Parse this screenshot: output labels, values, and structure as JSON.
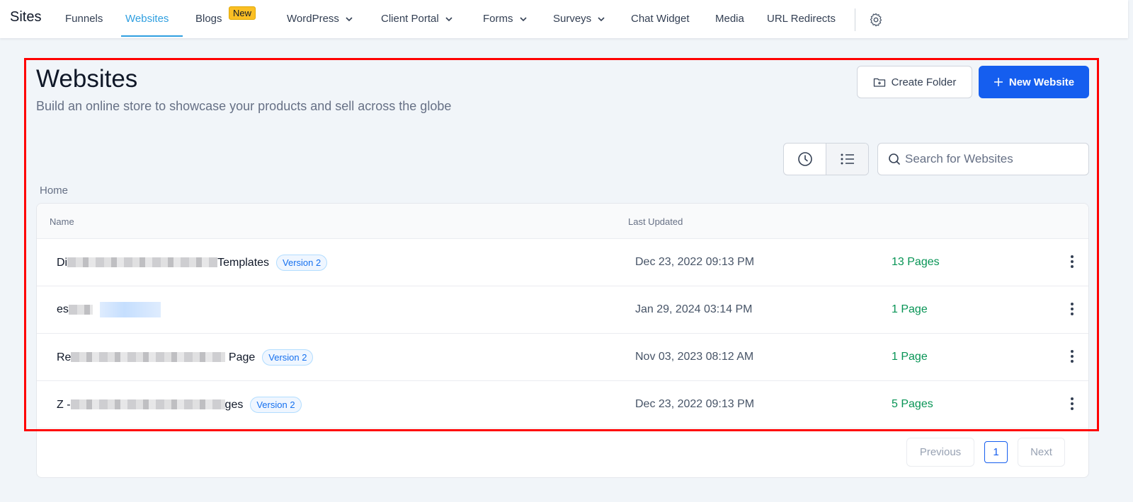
{
  "topnav": {
    "brand": "Sites",
    "items": [
      {
        "label": "Funnels",
        "active": false,
        "dropdown": false
      },
      {
        "label": "Websites",
        "active": true,
        "dropdown": false
      },
      {
        "label": "Blogs",
        "active": false,
        "dropdown": false,
        "badge": "New"
      },
      {
        "label": "WordPress",
        "active": false,
        "dropdown": true
      },
      {
        "label": "Client Portal",
        "active": false,
        "dropdown": true
      },
      {
        "label": "Forms",
        "active": false,
        "dropdown": true
      },
      {
        "label": "Surveys",
        "active": false,
        "dropdown": true
      },
      {
        "label": "Chat Widget",
        "active": false,
        "dropdown": false
      },
      {
        "label": "Media",
        "active": false,
        "dropdown": false
      },
      {
        "label": "URL Redirects",
        "active": false,
        "dropdown": false
      }
    ],
    "settings_icon": "gear-icon"
  },
  "header": {
    "title": "Websites",
    "subtitle": "Build an online store to showcase your products and sell across the globe",
    "create_folder_label": "Create Folder",
    "new_website_label": "New Website"
  },
  "toolbar": {
    "search_placeholder": "Search for Websites",
    "view_options": [
      "recent-clock-icon",
      "list-view-icon"
    ]
  },
  "breadcrumb": "Home",
  "table": {
    "columns": [
      "Name",
      "Last Updated"
    ],
    "rows": [
      {
        "name_prefix": "Di",
        "name_suffix": "Templates",
        "badge": "Version 2",
        "updated": "Dec 23, 2022 09:13 PM",
        "pages": "13 Pages"
      },
      {
        "name_prefix": "es",
        "name_suffix": "",
        "badge": "",
        "updated": "Jan 29, 2024 03:14 PM",
        "pages": "1 Page"
      },
      {
        "name_prefix": "Re",
        "name_suffix": "Page",
        "badge": "Version 2",
        "updated": "Nov 03, 2023 08:12 AM",
        "pages": "1 Page"
      },
      {
        "name_prefix": "Z -",
        "name_suffix": "ges",
        "badge": "Version 2",
        "updated": "Dec 23, 2022 09:13 PM",
        "pages": "5 Pages"
      }
    ]
  },
  "pagination": {
    "previous_label": "Previous",
    "current_page": "1",
    "next_label": "Next"
  },
  "colors": {
    "accent": "#155eef",
    "active_tab": "#2f9fe0",
    "pages_green": "#079455",
    "badge_new": "#fbbf24",
    "highlight": "#ff0000"
  }
}
